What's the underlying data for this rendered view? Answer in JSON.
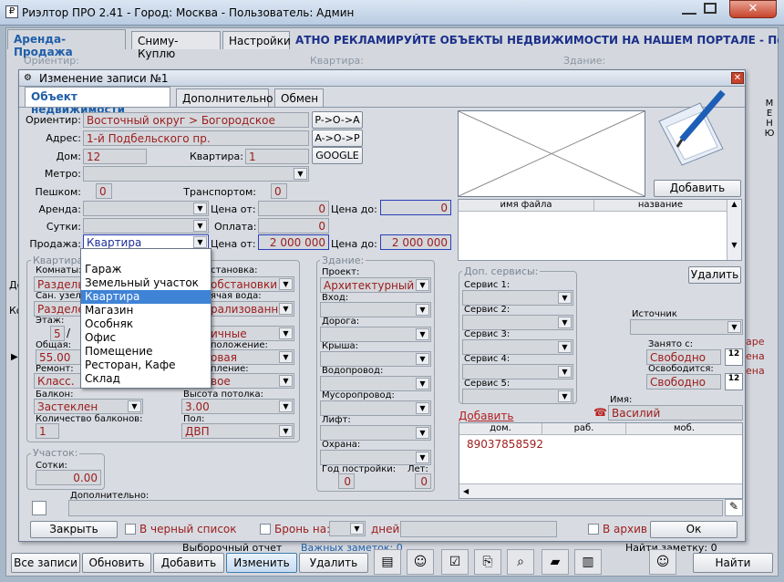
{
  "window": {
    "title": "Риэлтор ПРО 2.41 - Город: Москва - Пользователь: Админ",
    "close": "✕"
  },
  "main_tabs": [
    "Аренда-Продажа",
    "Сниму-Куплю",
    "Настройки"
  ],
  "marquee": "АТНО РЕКЛАМИРУЙТЕ ОБЪЕКТЫ НЕДВИЖИМОСТИ НА НАШЕМ ПОРТАЛЕ - Подробнее",
  "bg": {
    "orientir": "Ориентир:",
    "kvartira": "Квартира:",
    "zdanie": "Здание:",
    "menu": "М Е Н Ю",
    "vyborochny": "Выборочный отчет",
    "vazhnye": "Важных заметок: 0",
    "nayti_zametki": "Найти заметку: 0",
    "do": "До",
    "ko": "Ко",
    "sklad": "Склад"
  },
  "dialog": {
    "title": "Изменение записи №1",
    "tabs": [
      "Объект недвижимости",
      "Дополнительно",
      "Обмен"
    ],
    "orientir_label": "Ориентир:",
    "orientir": "Восточный округ > Богородское",
    "btn_poa": "P->O->A",
    "adres_label": "Адрес:",
    "adres": "1-й Подбельского пр.",
    "btn_aop": "A->O->P",
    "dom_label": "Дом:",
    "dom": "12",
    "kv_label": "Квартира:",
    "kv": "1",
    "btn_google": "GOOGLE",
    "metro_label": "Метро:",
    "metro": "",
    "peshkom_label": "Пешком:",
    "peshkom": "0",
    "transport_label": "Транспортом:",
    "transport": "0",
    "arenda_label": "Аренда:",
    "cena_ot_label": "Цена от:",
    "arenda_ot": "0",
    "cena_do_label": "Цена до:",
    "arenda_do": "0",
    "sutki_label": "Сутки:",
    "oplata_label": "Оплата:",
    "oplata": "0",
    "prodazha_label": "Продажа:",
    "prodazha": "Квартира",
    "prodazha_ot": "2 000 000",
    "prodazha_do": "2 000 000",
    "dropdown": [
      "",
      "Гараж",
      "Земельный участок",
      "Квартира",
      "Магазин",
      "Особняк",
      "Офис",
      "Помещение",
      "Ресторан, Кафе",
      "Склад"
    ],
    "dropdown_selected": 3,
    "kvartira_grp": "Квартира:",
    "komnaty_label": "Комнаты:",
    "komnaty": "Разделы",
    "obstanovka_label": "становка:",
    "obstanovka": "обстановки",
    "sanuzel_label": "Сан. узел:",
    "sanuzel": "Разделе",
    "voda_label": "ячая вода:",
    "voda": "рализованна",
    "etazh_label": "Этаж:",
    "etazh": "5",
    "etazh_sep": "/",
    "sostoyanie": "ичные",
    "obshaya_label": "Общая:",
    "obshaya": "55.00",
    "polozhenie_label": "положение:",
    "polozhenie": "овая",
    "remont_label": "Ремонт:",
    "remont": "Класс.",
    "tip_label": "пление:",
    "tip": "вое",
    "balkon_label": "Балкон:",
    "balkon": "Застеклен",
    "potolok_label": "Высота потолка:",
    "potolok": "3.00",
    "kol_balkon_label": "Количество балконов:",
    "kol_balkon": "1",
    "pol_label": "Пол:",
    "pol": "ДВП",
    "uchastok_grp": "Участок:",
    "sotki_label": "Сотки:",
    "sotki": "0.00",
    "zdanie_grp": "Здание:",
    "proekt_label": "Проект:",
    "proekt": "Архитектурный",
    "vhod_label": "Вход:",
    "doroga_label": "Дорога:",
    "krysha_label": "Крыша:",
    "vodoprovod_label": "Водопровод:",
    "musor_label": "Мусоропровод:",
    "lift_label": "Лифт:",
    "ohrana_label": "Охрана:",
    "god_label": "Год постройки:",
    "god": "0",
    "let_label": "Лет:",
    "let": "0",
    "btn_add_photo": "Добавить фото",
    "file_cols": [
      "имя файла",
      "название"
    ],
    "btn_delete": "Удалить",
    "dop_grp": "Доп. сервисы:",
    "servis": [
      "Сервис 1:",
      "Сервис 2:",
      "Сервис 3:",
      "Сервис 4:",
      "Сервис 5:"
    ],
    "istochnik_label": "Источник поступления:",
    "zanyato_label": "Занято с:",
    "zanyato": "Свободно",
    "osvob_label": "Освободится:",
    "osvob": "Свободно",
    "cal": "12",
    "imya_label": "Имя:",
    "imya": "Василий",
    "add_link": "Добавить",
    "phone_cols": [
      "дом.",
      "раб.",
      "моб."
    ],
    "phone": "89037858592",
    "dopolnitelno_label": "Дополнительно:",
    "btn_close": "Закрыть",
    "blacklist": "В черный список",
    "bron": "Бронь на:",
    "dney": "дней",
    "arhiv": "В архив",
    "btn_ok": "Ок"
  },
  "toolbar": [
    "Все записи",
    "Обновить",
    "Добавить",
    "Изменить",
    "Удалить"
  ],
  "btn_find": "Найти",
  "colors": {
    "accent": "#1f5ea8",
    "value": "#9b1c1c",
    "selection": "#3f83d6"
  }
}
